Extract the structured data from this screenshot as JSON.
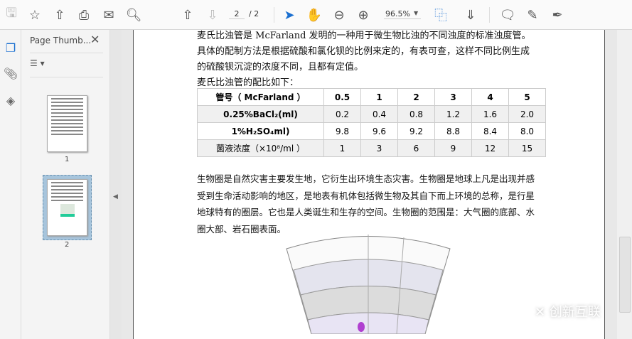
{
  "toolbar": {
    "page_current": "2",
    "page_total": "/ 2",
    "zoom": "96.5%"
  },
  "sidebar": {
    "title": "Page Thumb...",
    "thumbnails": [
      {
        "label": "1"
      },
      {
        "label": "2",
        "selected": true
      }
    ]
  },
  "document": {
    "para1": "麦氏比浊管是 McFarland 发明的一种用于微生物比浊的不同浊度的标准浊度管。具体的配制方法是根据硫酸和氯化钡的比例来定的，有表可查，这样不同比例生成的硫酸钡沉淀的浓度不同，且都有定值。",
    "para2": "麦氏比浊管的配比如下：",
    "table": {
      "rows": [
        [
          "管号（ McFarland ）",
          "0.5",
          "1",
          "2",
          "3",
          "4",
          "5"
        ],
        [
          "0.25%BaCl₂(ml)",
          "0.2",
          "0.4",
          "0.8",
          "1.2",
          "1.6",
          "2.0"
        ],
        [
          "1%H₂SO₄ml)",
          "9.8",
          "9.6",
          "9.2",
          "8.8",
          "8.4",
          "8.0"
        ],
        [
          "菌液浓度（×10⁸/ml ）",
          "1",
          "3",
          "6",
          "9",
          "12",
          "15"
        ]
      ]
    },
    "para3": "生物圈是自然灾害主要发生地，它衍生出环境生态灾害。生物圈是地球上凡是出现并感受到生命活动影响的地区，是地表有机体包括微生物及其自下而上环境的总称，是行星地球特有的圈层。它也是人类诞生和生存的空间。生物圈的范围是：大气圈的底部、水圈大部、岩石圈表面。"
  },
  "watermark": "创新互联",
  "colors": {
    "accent": "#1a6fd0"
  }
}
